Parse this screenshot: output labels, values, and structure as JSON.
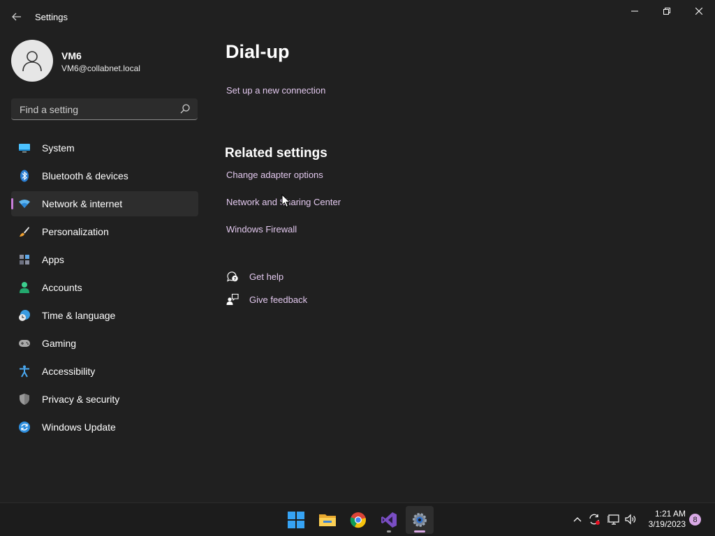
{
  "window": {
    "app_title": "Settings",
    "back_icon": "arrow-left-icon",
    "controls": [
      "minimize-icon",
      "restore-icon",
      "close-icon"
    ]
  },
  "user": {
    "name": "VM6",
    "email": "VM6@collabnet.local",
    "avatar_icon": "person-icon"
  },
  "search": {
    "placeholder": "Find a setting",
    "value": "",
    "icon": "search-icon"
  },
  "nav": {
    "items": [
      {
        "label": "System",
        "icon": "monitor-icon",
        "active": false
      },
      {
        "label": "Bluetooth & devices",
        "icon": "bluetooth-icon",
        "active": false
      },
      {
        "label": "Network & internet",
        "icon": "wifi-icon",
        "active": true
      },
      {
        "label": "Personalization",
        "icon": "brush-icon",
        "active": false
      },
      {
        "label": "Apps",
        "icon": "apps-icon",
        "active": false
      },
      {
        "label": "Accounts",
        "icon": "account-icon",
        "active": false
      },
      {
        "label": "Time & language",
        "icon": "clock-globe-icon",
        "active": false
      },
      {
        "label": "Gaming",
        "icon": "gamepad-icon",
        "active": false
      },
      {
        "label": "Accessibility",
        "icon": "accessibility-icon",
        "active": false
      },
      {
        "label": "Privacy & security",
        "icon": "shield-icon",
        "active": false
      },
      {
        "label": "Windows Update",
        "icon": "update-icon",
        "active": false
      }
    ]
  },
  "main": {
    "page_title": "Dial-up",
    "setup_link": "Set up a new connection",
    "related_title": "Related settings",
    "related_links": [
      "Change adapter options",
      "Network and Sharing Center",
      "Windows Firewall"
    ],
    "help": {
      "get_help": "Get help",
      "give_feedback": "Give feedback"
    }
  },
  "taskbar": {
    "apps": [
      {
        "name": "Start",
        "icon": "windows-logo-icon"
      },
      {
        "name": "File Explorer",
        "icon": "folder-icon"
      },
      {
        "name": "Google Chrome",
        "icon": "chrome-icon"
      },
      {
        "name": "Visual Studio",
        "icon": "visual-studio-icon"
      },
      {
        "name": "Settings",
        "icon": "gear-icon"
      }
    ],
    "tray": {
      "icons": [
        "chevron-up-icon",
        "sync-icon",
        "network-icon",
        "volume-icon"
      ],
      "time": "1:21 AM",
      "date": "3/19/2023",
      "notification_count": "8"
    }
  },
  "colors": {
    "background": "#202020",
    "accent": "#c77dd8",
    "link": "#e2c8ee",
    "taskbar": "#1c1c1c"
  }
}
